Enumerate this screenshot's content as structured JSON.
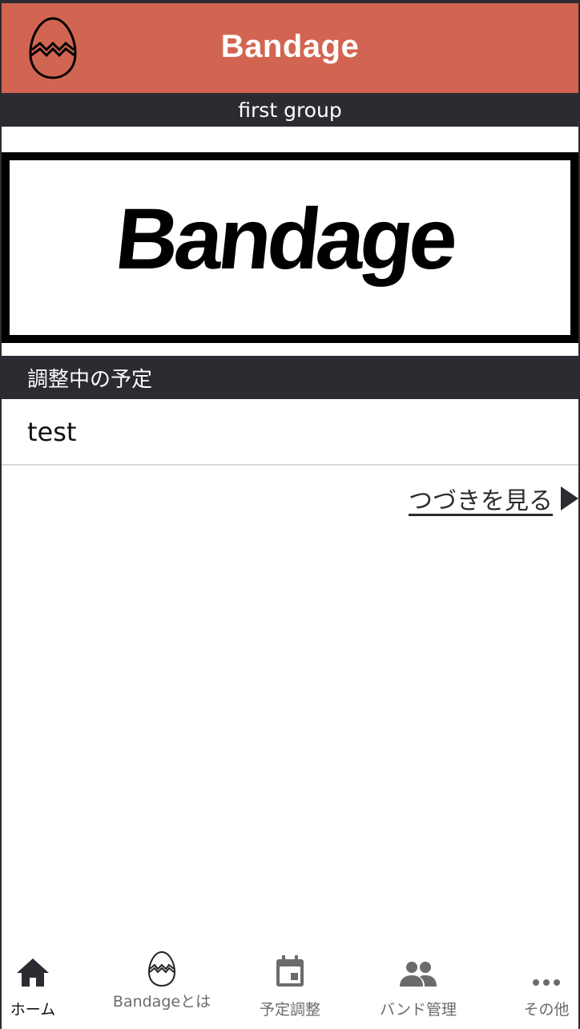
{
  "header": {
    "title": "Bandage",
    "logo_icon": "egg-icon",
    "background": "#d26551"
  },
  "group": {
    "name": "first group"
  },
  "banner": {
    "logo_text": "Bandage"
  },
  "pending_schedules": {
    "title": "調整中の予定",
    "items": [
      {
        "label": "test"
      }
    ],
    "more_link": "つづきを見る"
  },
  "tabbar": {
    "tabs": [
      {
        "label": "ホーム",
        "icon": "home-icon",
        "active": true
      },
      {
        "label": "Bandageとは",
        "icon": "egg-icon",
        "active": false
      },
      {
        "label": "予定調整",
        "icon": "calendar-icon",
        "active": false
      },
      {
        "label": "バンド管理",
        "icon": "people-icon",
        "active": false
      },
      {
        "label": "その他",
        "icon": "more-icon",
        "active": false
      }
    ]
  },
  "colors": {
    "accent": "#d26551",
    "dark": "#2c2b31",
    "tab_inactive": "#6b6b6b"
  }
}
